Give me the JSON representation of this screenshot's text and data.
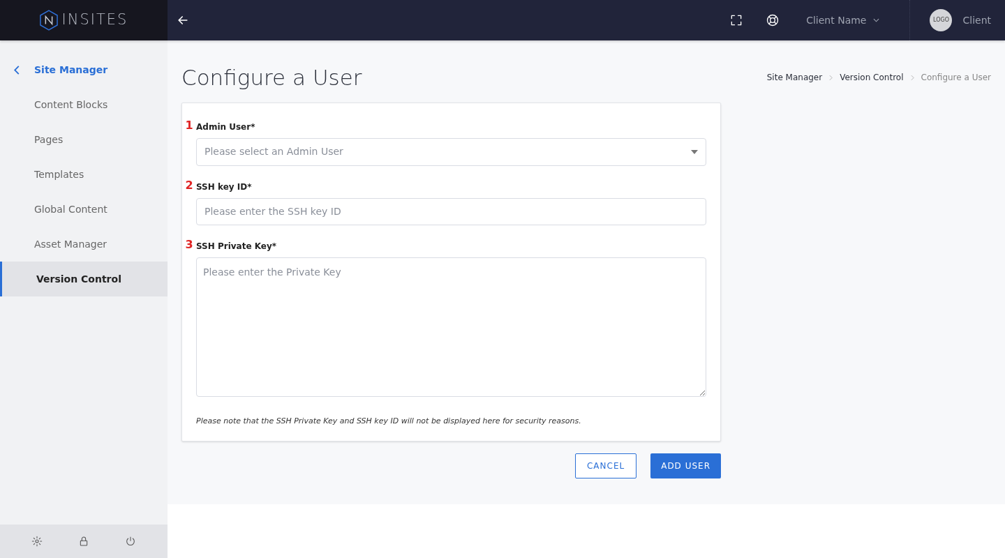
{
  "header": {
    "logo": "INSITES",
    "client_selector": "Client Name",
    "avatar": "LOGO",
    "account": "Client"
  },
  "sidebar": {
    "back_item": "Site Manager",
    "items": [
      {
        "label": "Content Blocks",
        "selected": false
      },
      {
        "label": "Pages",
        "selected": false
      },
      {
        "label": "Templates",
        "selected": false
      },
      {
        "label": "Global Content",
        "selected": false
      },
      {
        "label": "Asset Manager",
        "selected": false
      },
      {
        "label": "Version Control",
        "selected": true
      }
    ]
  },
  "page": {
    "title": "Configure a User",
    "breadcrumbs": [
      "Site Manager",
      "Version Control",
      "Configure a User"
    ]
  },
  "form": {
    "fields": [
      {
        "marker": "1",
        "label": "Admin User*",
        "kind": "select",
        "placeholder": "Please select an Admin User"
      },
      {
        "marker": "2",
        "label": "SSH key ID*",
        "kind": "input",
        "placeholder": "Please enter the SSH key ID"
      },
      {
        "marker": "3",
        "label": "SSH Private Key*",
        "kind": "textarea",
        "placeholder": "Please enter the Private Key"
      }
    ],
    "note": "Please note that the SSH Private Key and SSH key ID will not be displayed here for security reasons."
  },
  "buttons": {
    "cancel": "CANCEL",
    "submit": "ADD USER"
  }
}
